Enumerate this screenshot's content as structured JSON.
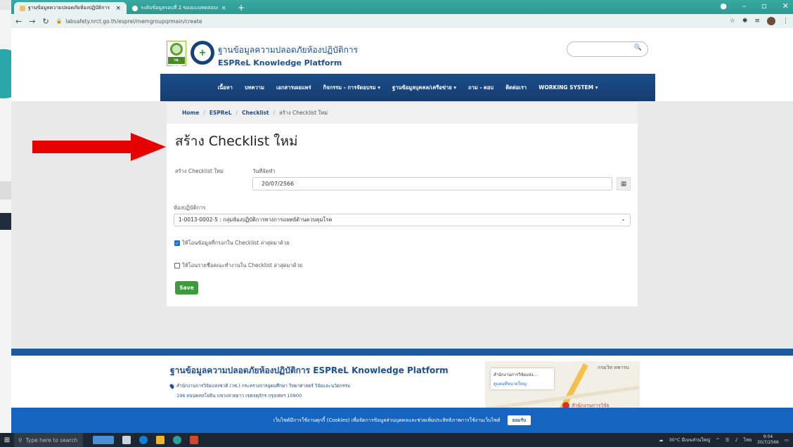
{
  "browser": {
    "tabs": [
      {
        "title": "ฐานข้อมูลความปลอดภัยห้องปฏิบัติการ",
        "active": true
      },
      {
        "title": "ระดับข้อมูลรอบที่ 2 ของแบบทดสอบการ",
        "active": false
      }
    ],
    "url": "labsafety.nrct.go.th/esprel/memgroupqrmain/create"
  },
  "site": {
    "title_th": "ฐานข้อมูลความปลอดภัยห้องปฏิบัติการ",
    "title_en": "ESPReL Knowledge Platform",
    "logo1_band": "วช. NRCT",
    "search_placeholder": ""
  },
  "nav": {
    "items": [
      "เนื้อหา",
      "บทความ",
      "เอกสารเผยแพร่",
      "กิจกรรม - การจัดอบรม ▾",
      "ฐานข้อมูลบุคคล/เครือข่าย ▾",
      "ถาม - ตอบ",
      "ติดต่อเรา",
      "WORKING SYSTEM ▾"
    ]
  },
  "breadcrumb": {
    "home": "Home",
    "esprel": "ESPReL",
    "checklist": "Checklist",
    "current": "สร้าง Checklist ใหม่"
  },
  "form": {
    "heading": "สร้าง Checklist ใหม่",
    "left_label": "สร้าง Checklist ใหม่",
    "date_label": "วันที่จัดทำ",
    "date_value": "20/07/2566",
    "lab_label": "ห้องปฏิบัติการ",
    "lab_value": "1-0013-0002-5 : กลุ่มห้องปฏิบัติการทางการแพทย์ด้านควบคุมโรค",
    "checkbox1": "ให้โอนข้อมูลที่กรอกใน Checklist ล่าสุดมาด้วย",
    "checkbox1_checked": true,
    "checkbox2": "ให้โอนรายชื่อคณะทำงานใน Checklist ล่าสุดมาด้วย",
    "checkbox2_checked": false,
    "save_label": "Save"
  },
  "footer": {
    "title": "ฐานข้อมูลความปลอดภัยห้องปฏิบัติการ ESPReL Knowledge Platform",
    "line1": "สำนักงานการวิจัยแห่งชาติ (วช.) กระทรวงการอุดมศึกษา วิทยาศาสตร์ วิจัยและนวัตกรรม",
    "line2": "196 ถนนพหลโยธิน แขวงลาดยาว เขตจตุจักร กรุงเทพฯ 10900",
    "map_card_title": "สำนักงานการวิจัยแห่ง...",
    "map_card_sub": "ดูแผนที่ขนาดใหญ่",
    "map_label_marker": "สำนักงานการวิจัย",
    "map_label_right": "กรมวิท ทหารบ"
  },
  "cookie": {
    "text": "เว็บไซต์มีการใช้งานคุกกี้ (Cookies) เพื่อจัดการข้อมูลส่วนบุคคลและช่วยเพิ่มประสิทธิภาพการใช้งานเว็บไซต์",
    "accept": "ยอมรับ"
  },
  "taskbar": {
    "search_placeholder": "Type here to search",
    "weather": "30°C มีเมฆส่วนใหญ่",
    "lang": "ไทย",
    "time": "9:04",
    "date": "20/7/2566"
  },
  "colors": {
    "accent": "#1d4f91",
    "nav_bg": "#1b4d8a",
    "save": "#3d9b3d",
    "arrow": "#e60000"
  }
}
